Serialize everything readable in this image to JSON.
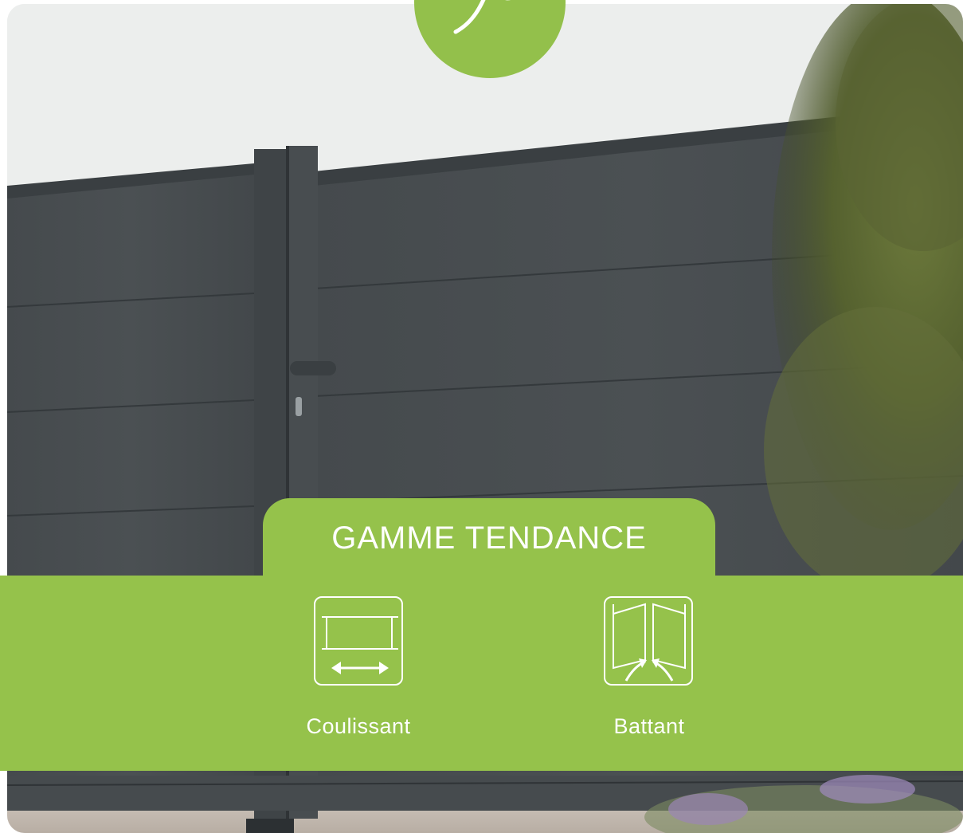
{
  "brand_color": "#95c24b",
  "badge": {
    "icon": "leaf-icon"
  },
  "title": "GAMME TENDANCE",
  "options": [
    {
      "label": "Coulissant",
      "icon": "sliding-gate-icon"
    },
    {
      "label": "Battant",
      "icon": "swing-gate-icon"
    }
  ],
  "photo": {
    "subject": "gate-photo"
  }
}
